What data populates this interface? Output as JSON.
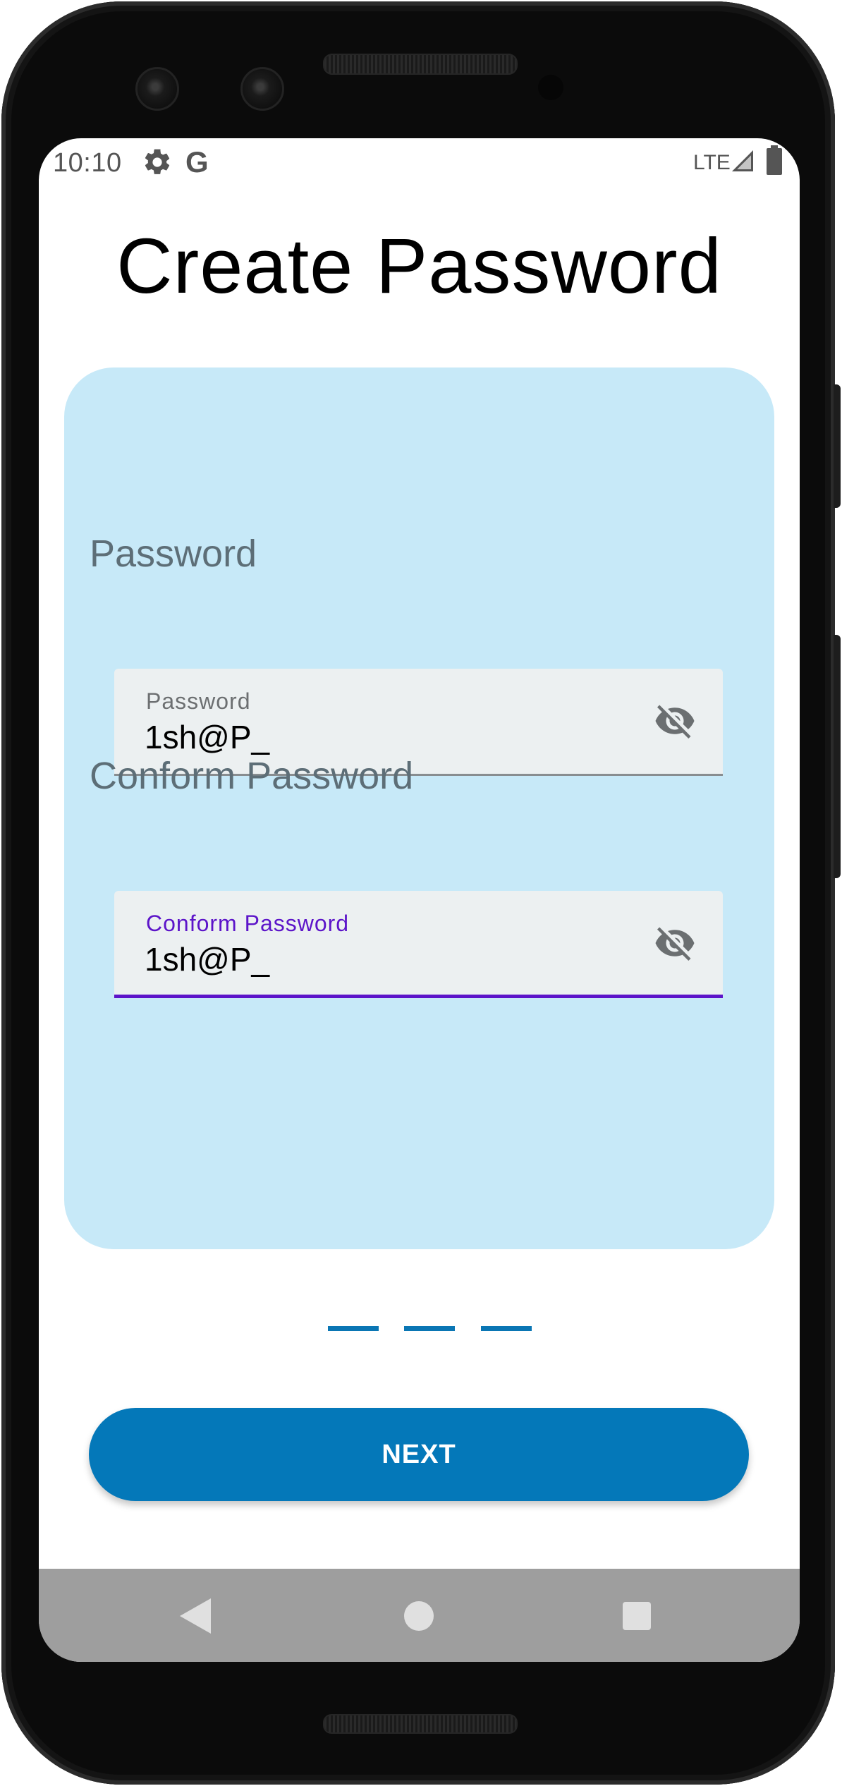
{
  "status_bar": {
    "time": "10:10",
    "google_glyph": "G",
    "network": "LTE",
    "icons": [
      "gear-icon",
      "google-icon",
      "signal-icon",
      "battery-icon"
    ]
  },
  "header": {
    "title": "Create Password"
  },
  "form": {
    "password": {
      "section_label": "Password",
      "floating_label": "Password",
      "value": "1sh@P_",
      "toggle_icon": "eye-off-icon",
      "focused": false
    },
    "confirm_password": {
      "section_label": "Conform Password",
      "floating_label": "Conform Password",
      "value": "1sh@P_",
      "toggle_icon": "eye-off-icon",
      "focused": true
    }
  },
  "pager": {
    "count": 3
  },
  "actions": {
    "next_label": "NEXT"
  },
  "nav_bar": {
    "icons": [
      "back-icon",
      "home-icon",
      "recents-icon"
    ]
  },
  "colors": {
    "card_background": "#c7e9f8",
    "accent_focus": "#5c14c9",
    "primary_button": "#0478b9",
    "page_indicator": "#0a76b4",
    "field_background": "#ecf0f1",
    "nav_bar": "#9e9e9e"
  }
}
